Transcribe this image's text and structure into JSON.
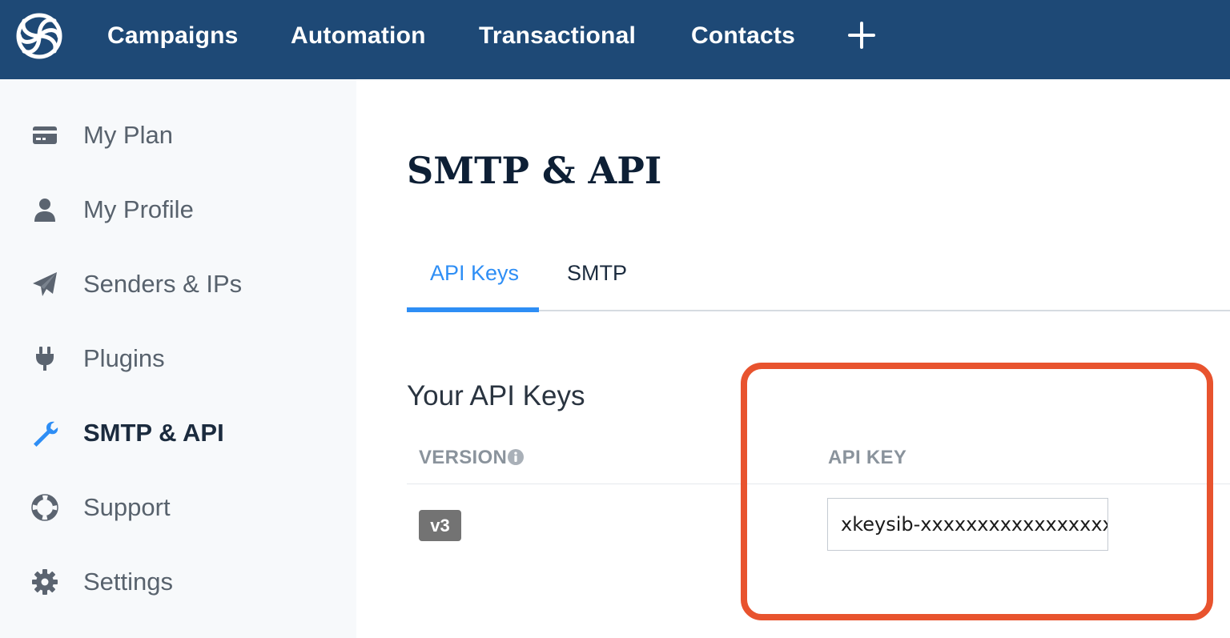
{
  "nav": {
    "items": [
      {
        "label": "Campaigns"
      },
      {
        "label": "Automation"
      },
      {
        "label": "Transactional"
      },
      {
        "label": "Contacts"
      }
    ],
    "plus_icon": "plus-icon",
    "logo_icon": "sendinblue-logo-icon",
    "background": "#1e4976"
  },
  "sidebar": {
    "items": [
      {
        "label": "My Plan",
        "icon": "credit-card-icon"
      },
      {
        "label": "My Profile",
        "icon": "user-icon"
      },
      {
        "label": "Senders & IPs",
        "icon": "paper-plane-icon"
      },
      {
        "label": "Plugins",
        "icon": "plug-icon"
      },
      {
        "label": "SMTP & API",
        "icon": "wrench-icon",
        "active": true
      },
      {
        "label": "Support",
        "icon": "lifebuoy-icon"
      },
      {
        "label": "Settings",
        "icon": "gear-icon"
      }
    ]
  },
  "main": {
    "title": "SMTP & API",
    "tabs": [
      {
        "label": "API Keys",
        "active": true
      },
      {
        "label": "SMTP"
      }
    ],
    "section_title": "Your API Keys",
    "table": {
      "headers": {
        "version": "VERSION",
        "api_key": "API KEY"
      },
      "rows": [
        {
          "version": "v3",
          "api_key": "xkeysib-xxxxxxxxxxxxxxxxxx"
        }
      ]
    }
  },
  "colors": {
    "accent": "#2e8ef5",
    "highlight": "#e8532e",
    "badge": "#737373"
  }
}
